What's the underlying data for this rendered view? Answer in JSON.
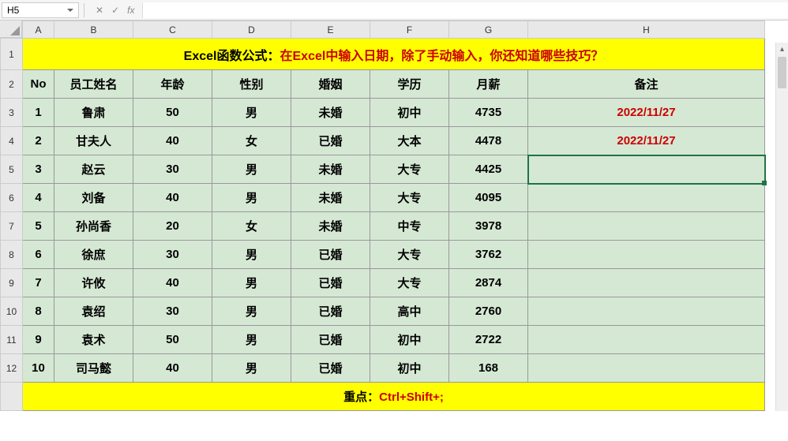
{
  "formula_bar": {
    "name_box": "H5",
    "fx_label": "fx",
    "cancel": "✕",
    "confirm": "✓"
  },
  "columns": [
    "A",
    "B",
    "C",
    "D",
    "E",
    "F",
    "G",
    "H"
  ],
  "rows": [
    "1",
    "2",
    "3",
    "4",
    "5",
    "6",
    "7",
    "8",
    "9",
    "10",
    "11",
    "12"
  ],
  "title": {
    "prefix": "Excel函数公式：",
    "content": "在Excel中输入日期，除了手动输入，你还知道哪些技巧？"
  },
  "headers": {
    "no": "No",
    "name": "员工姓名",
    "age": "年龄",
    "gender": "性别",
    "marriage": "婚姻",
    "education": "学历",
    "salary": "月薪",
    "remark": "备注"
  },
  "data": [
    {
      "no": "1",
      "name": "鲁肃",
      "age": "50",
      "gender": "男",
      "marriage": "未婚",
      "education": "初中",
      "salary": "4735",
      "remark": "2022/11/27"
    },
    {
      "no": "2",
      "name": "甘夫人",
      "age": "40",
      "gender": "女",
      "marriage": "已婚",
      "education": "大本",
      "salary": "4478",
      "remark": "2022/11/27"
    },
    {
      "no": "3",
      "name": "赵云",
      "age": "30",
      "gender": "男",
      "marriage": "未婚",
      "education": "大专",
      "salary": "4425",
      "remark": ""
    },
    {
      "no": "4",
      "name": "刘备",
      "age": "40",
      "gender": "男",
      "marriage": "未婚",
      "education": "大专",
      "salary": "4095",
      "remark": ""
    },
    {
      "no": "5",
      "name": "孙尚香",
      "age": "20",
      "gender": "女",
      "marriage": "未婚",
      "education": "中专",
      "salary": "3978",
      "remark": ""
    },
    {
      "no": "6",
      "name": "徐庶",
      "age": "30",
      "gender": "男",
      "marriage": "已婚",
      "education": "大专",
      "salary": "3762",
      "remark": ""
    },
    {
      "no": "7",
      "name": "许攸",
      "age": "40",
      "gender": "男",
      "marriage": "已婚",
      "education": "大专",
      "salary": "2874",
      "remark": ""
    },
    {
      "no": "8",
      "name": "袁绍",
      "age": "30",
      "gender": "男",
      "marriage": "已婚",
      "education": "高中",
      "salary": "2760",
      "remark": ""
    },
    {
      "no": "9",
      "name": "袁术",
      "age": "50",
      "gender": "男",
      "marriage": "已婚",
      "education": "初中",
      "salary": "2722",
      "remark": ""
    },
    {
      "no": "10",
      "name": "司马懿",
      "age": "40",
      "gender": "男",
      "marriage": "已婚",
      "education": "初中",
      "salary": "168",
      "remark": ""
    }
  ],
  "footer": {
    "prefix": "重点：",
    "shortcut": "Ctrl+Shift+;"
  },
  "selected_cell": "H5"
}
